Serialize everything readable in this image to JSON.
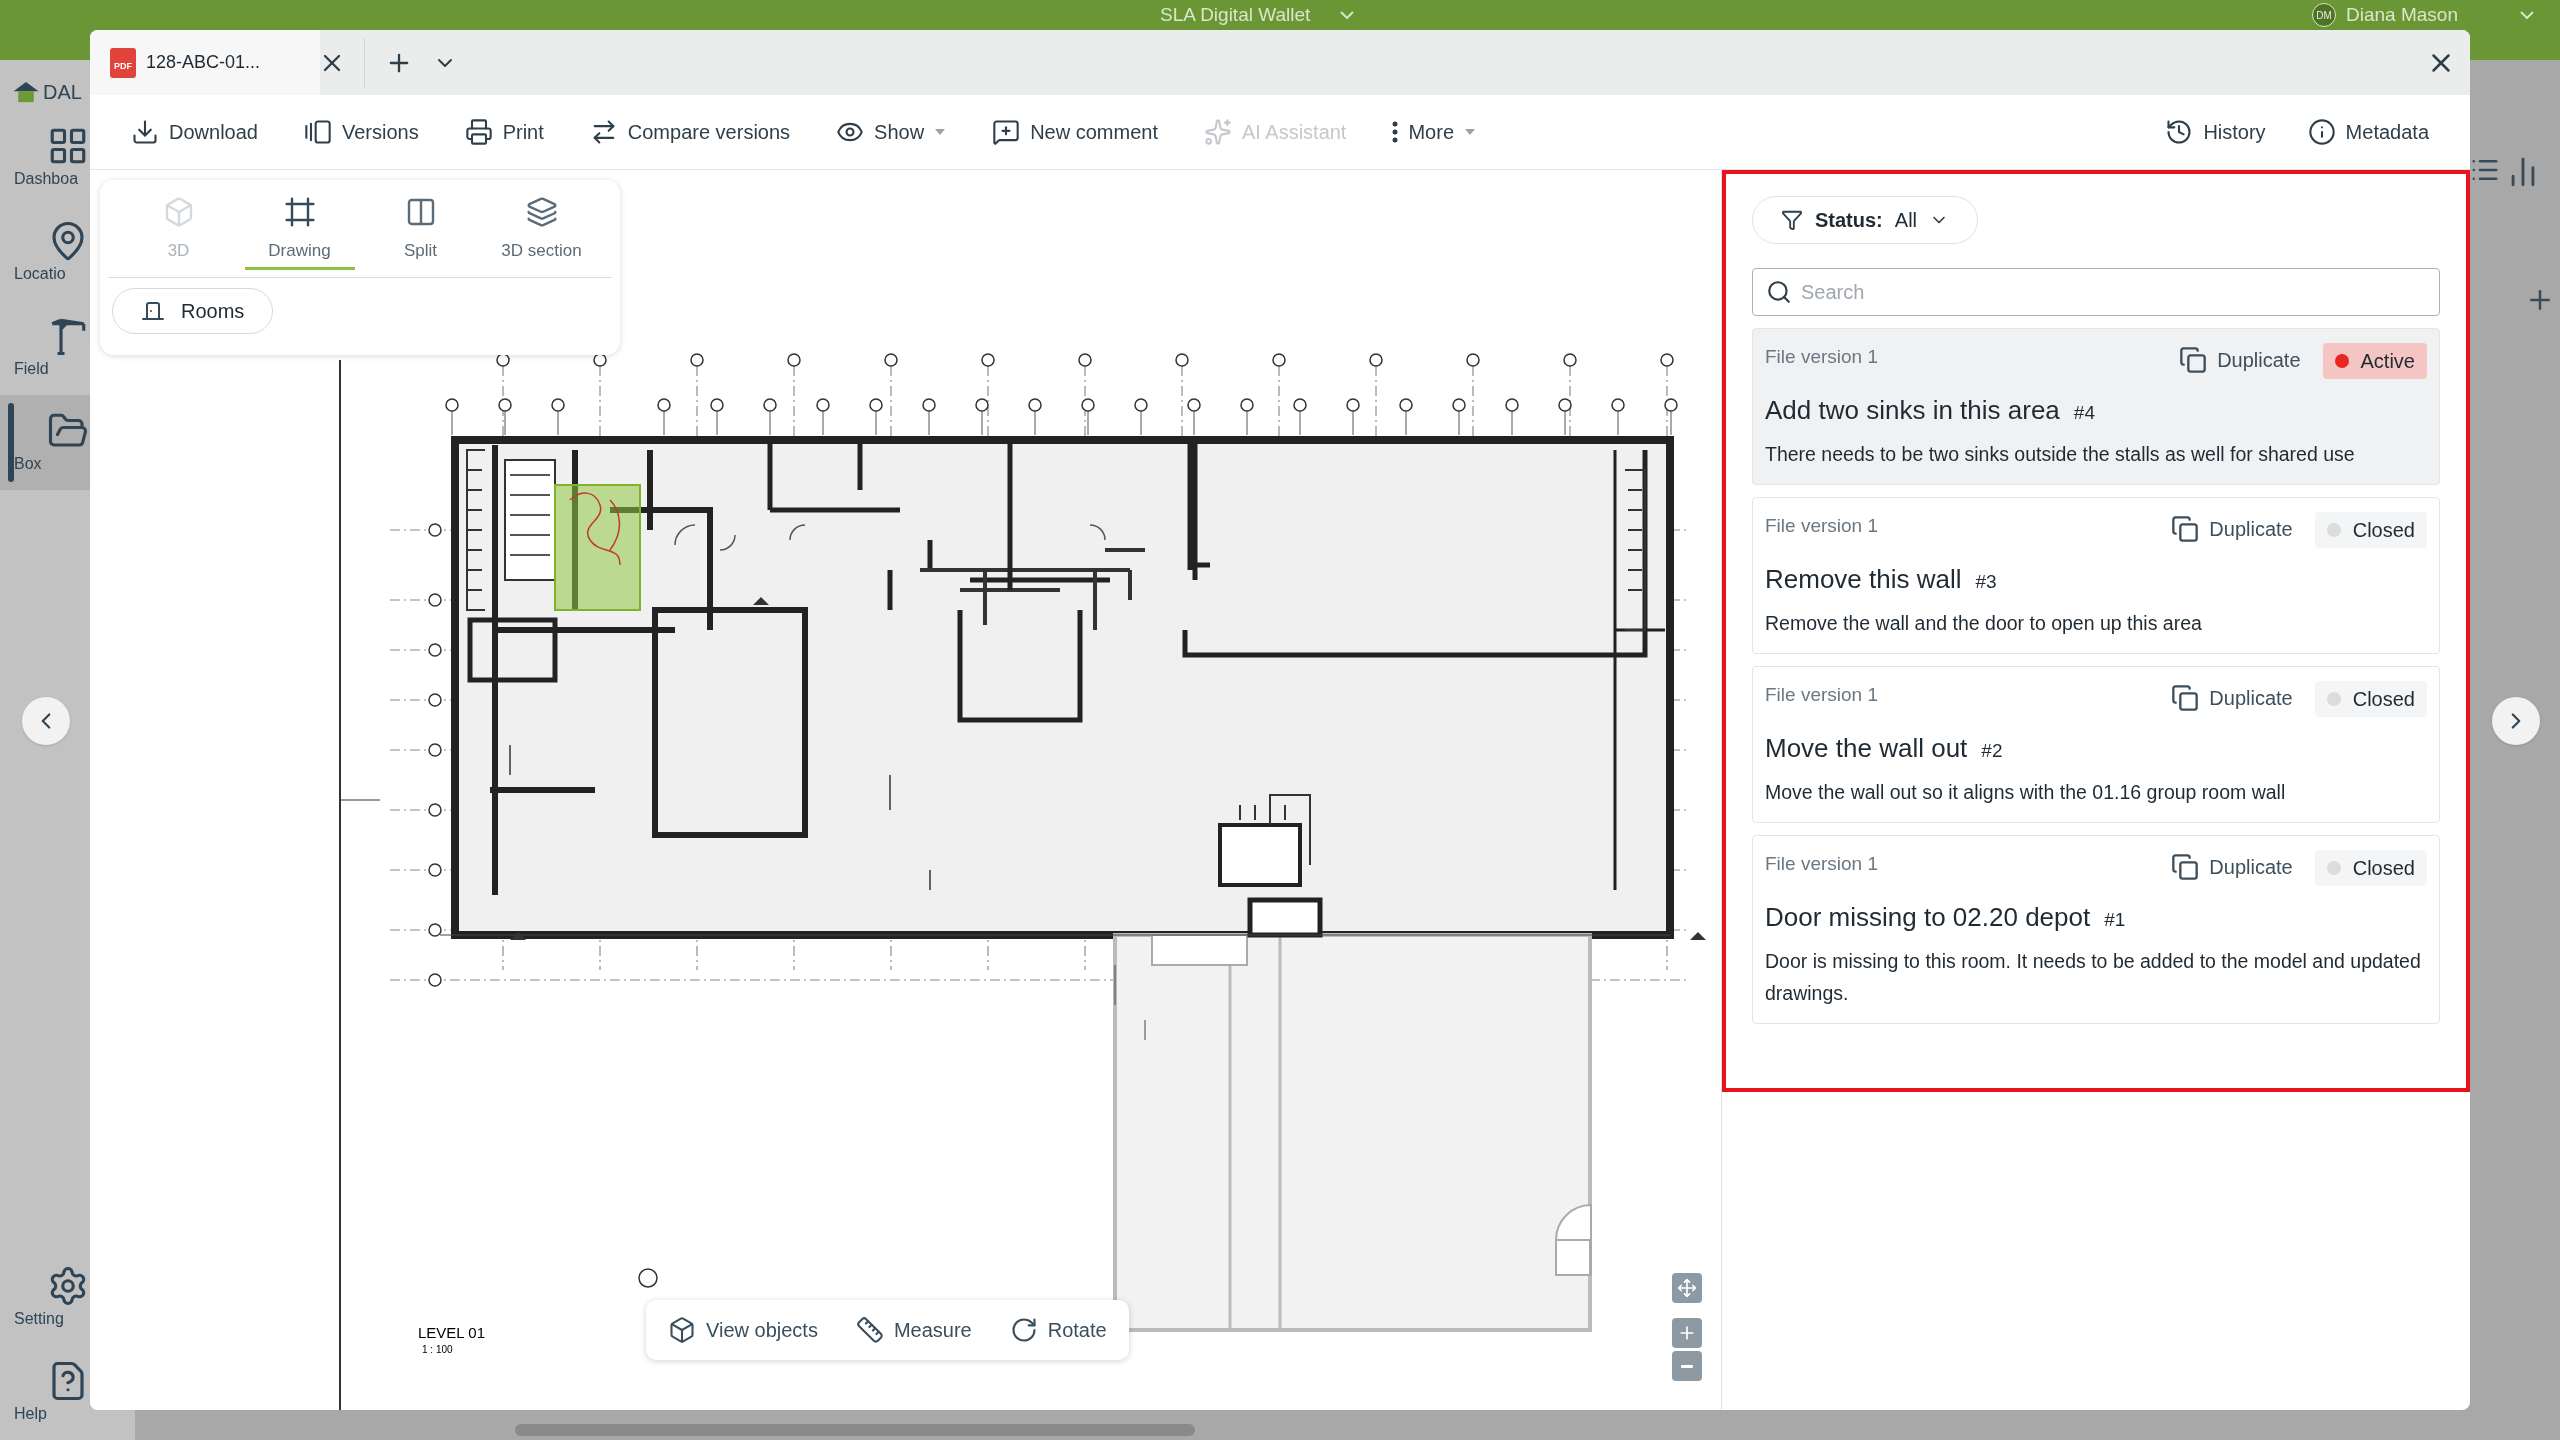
{
  "app": {
    "title": "SLA Digital Wallet",
    "user": {
      "initials": "DM",
      "name": "Diana Mason"
    },
    "logo": "DAL",
    "nav": [
      {
        "label": "Dashboa",
        "selected": false
      },
      {
        "label": "Locatio",
        "selected": false
      },
      {
        "label": "Field",
        "selected": false
      },
      {
        "label": "Box",
        "selected": true
      }
    ],
    "nav_bottom": [
      {
        "label": "Setting"
      },
      {
        "label": "Help"
      }
    ]
  },
  "viewer": {
    "tab": {
      "badge": "PDF",
      "title": "128-ABC-01..."
    },
    "toolbar": [
      {
        "label": "Download",
        "disabled": false,
        "dropdown": false
      },
      {
        "label": "Versions",
        "disabled": false,
        "dropdown": false
      },
      {
        "label": "Print",
        "disabled": false,
        "dropdown": false
      },
      {
        "label": "Compare versions",
        "disabled": false,
        "dropdown": false
      },
      {
        "label": "Show",
        "disabled": false,
        "dropdown": true
      },
      {
        "label": "New comment",
        "disabled": false,
        "dropdown": false
      },
      {
        "label": "AI Assistant",
        "disabled": true,
        "dropdown": false
      },
      {
        "label": "More",
        "disabled": false,
        "dropdown": true
      }
    ],
    "toolbar_right": [
      {
        "label": "History"
      },
      {
        "label": "Metadata"
      }
    ],
    "view_modes": [
      {
        "label": "3D",
        "selected": false,
        "disabled": true
      },
      {
        "label": "Drawing",
        "selected": true,
        "disabled": false
      },
      {
        "label": "Split",
        "selected": false,
        "disabled": false
      },
      {
        "label": "3D section",
        "selected": false,
        "disabled": false
      }
    ],
    "rooms_button": "Rooms",
    "drawing": {
      "level": "LEVEL 01",
      "scale": "1 : 100"
    },
    "bottom_tools": [
      {
        "label": "View objects"
      },
      {
        "label": "Measure"
      },
      {
        "label": "Rotate"
      }
    ]
  },
  "comments_panel": {
    "filter": {
      "label": "Status:",
      "value": "All"
    },
    "search": {
      "placeholder": "Search"
    },
    "comments": [
      {
        "version": "File version 1",
        "action": "Duplicate",
        "status": "Active",
        "color": "#e8281e",
        "selected": true,
        "title": "Add two sinks in this area",
        "number": "#4",
        "body": "There needs to be two sinks outside the stalls as well for shared use"
      },
      {
        "version": "File version 1",
        "action": "Duplicate",
        "status": "Closed",
        "color": "#dcdcdc",
        "selected": false,
        "title": "Remove this wall",
        "number": "#3",
        "body": "Remove the wall and the door to open up this area"
      },
      {
        "version": "File version 1",
        "action": "Duplicate",
        "status": "Closed",
        "color": "#dcdcdc",
        "selected": false,
        "title": "Move the wall out",
        "number": "#2",
        "body": "Move the wall out so it aligns with the 01.16 group room wall"
      },
      {
        "version": "File version 1",
        "action": "Duplicate",
        "status": "Closed",
        "color": "#dcdcdc",
        "selected": false,
        "title": "Door missing to 02.20 depot",
        "number": "#1",
        "body": "Door is missing to this room. It needs to be added to the model and updated drawings."
      }
    ]
  }
}
